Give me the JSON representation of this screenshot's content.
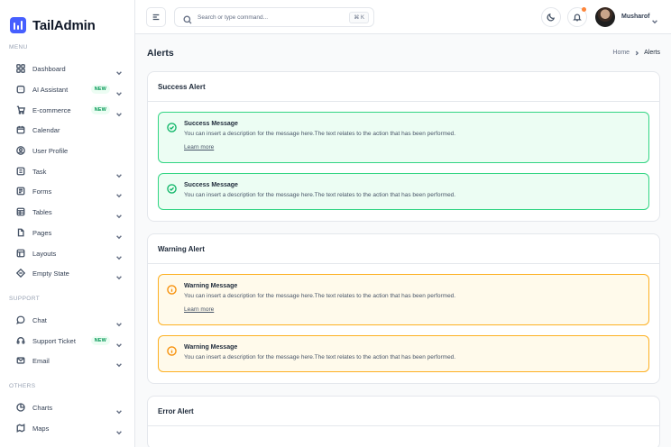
{
  "app": {
    "name": "TailAdmin"
  },
  "sidebar": {
    "sections": [
      {
        "title": "MENU"
      },
      {
        "title": "SUPPORT"
      },
      {
        "title": "OTHERS"
      }
    ],
    "items": [
      {
        "label": "Dashboard",
        "icon": "grid-icon",
        "badge": "",
        "chevron": true
      },
      {
        "label": "AI Assistant",
        "icon": "ai-assistant-icon",
        "badge": "NEW",
        "chevron": true
      },
      {
        "label": "E-commerce",
        "icon": "cart-icon",
        "badge": "NEW",
        "chevron": true
      },
      {
        "label": "Calendar",
        "icon": "calendar-icon",
        "badge": "",
        "chevron": false
      },
      {
        "label": "User Profile",
        "icon": "user-circle-icon",
        "badge": "",
        "chevron": false
      },
      {
        "label": "Task",
        "icon": "task-icon",
        "badge": "",
        "chevron": true
      },
      {
        "label": "Forms",
        "icon": "forms-icon",
        "badge": "",
        "chevron": true
      },
      {
        "label": "Tables",
        "icon": "table-icon",
        "badge": "",
        "chevron": true
      },
      {
        "label": "Pages",
        "icon": "pages-icon",
        "badge": "",
        "chevron": true
      },
      {
        "label": "Layouts",
        "icon": "layouts-icon",
        "badge": "",
        "chevron": true
      },
      {
        "label": "Empty State",
        "icon": "empty-state-icon",
        "badge": "",
        "chevron": true
      },
      {
        "label": "Chat",
        "icon": "chat-icon",
        "badge": "",
        "chevron": true
      },
      {
        "label": "Support Ticket",
        "icon": "headset-icon",
        "badge": "NEW",
        "chevron": true
      },
      {
        "label": "Email",
        "icon": "mail-icon",
        "badge": "",
        "chevron": true
      },
      {
        "label": "Charts",
        "icon": "pie-chart-icon",
        "badge": "",
        "chevron": true
      },
      {
        "label": "Maps",
        "icon": "map-icon",
        "badge": "",
        "chevron": true
      }
    ]
  },
  "header": {
    "search_placeholder": "Search or type command...",
    "shortcut": "⌘ K",
    "user_name": "Musharof"
  },
  "page": {
    "title": "Alerts",
    "breadcrumb": {
      "home": "Home",
      "current": "Alerts"
    }
  },
  "cards": [
    {
      "title": "Success Alert",
      "alerts": [
        {
          "type": "success",
          "title": "Success Message",
          "description": "You can insert a description for the message here.The text relates to the action that has been performed.",
          "link": "Learn more"
        },
        {
          "type": "success",
          "title": "Success Message",
          "description": "You can insert a description for the message here.The text relates to the action that has been performed.",
          "link": ""
        }
      ]
    },
    {
      "title": "Warning Alert",
      "alerts": [
        {
          "type": "warning",
          "title": "Warning Message",
          "description": "You can insert a description for the message here.The text relates to the action that has been performed.",
          "link": "Learn more"
        },
        {
          "type": "warning",
          "title": "Warning Message",
          "description": "You can insert a description for the message here.The text relates to the action that has been performed.",
          "link": ""
        }
      ]
    },
    {
      "title": "Error Alert",
      "alerts": []
    }
  ],
  "colors": {
    "brand": "#465fff",
    "success_border": "#32d583",
    "success_bg": "#ecfdf3",
    "warning_border": "#fdb022",
    "warning_bg": "#fffaeb",
    "badge_text": "#039855",
    "notification_dot": "#fd853a"
  }
}
